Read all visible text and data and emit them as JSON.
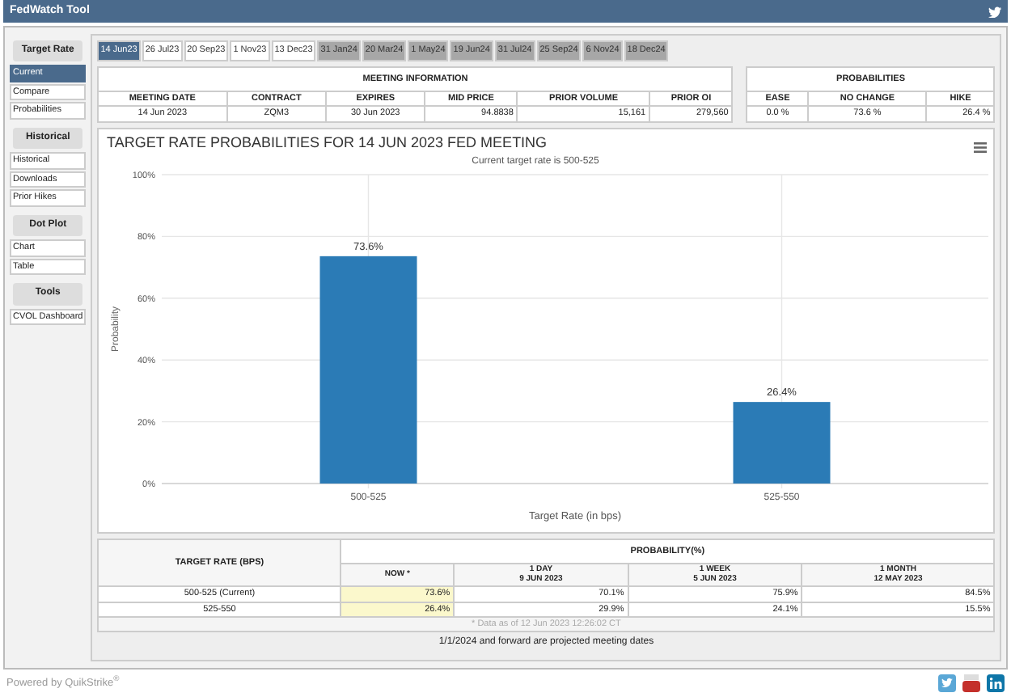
{
  "window": {
    "title": "FedWatch Tool"
  },
  "sidebar": {
    "groups": [
      {
        "heading": "Target Rate",
        "items": [
          {
            "label": "Current",
            "selected": true
          },
          {
            "label": "Compare",
            "selected": false
          },
          {
            "label": "Probabilities",
            "selected": false
          }
        ]
      },
      {
        "heading": "Historical",
        "items": [
          {
            "label": "Historical",
            "selected": false
          },
          {
            "label": "Downloads",
            "selected": false
          },
          {
            "label": "Prior Hikes",
            "selected": false
          }
        ]
      },
      {
        "heading": "Dot Plot",
        "items": [
          {
            "label": "Chart",
            "selected": false
          },
          {
            "label": "Table",
            "selected": false
          }
        ]
      },
      {
        "heading": "Tools",
        "items": [
          {
            "label": "CVOL Dashboard",
            "selected": false
          }
        ]
      }
    ]
  },
  "tabs": [
    {
      "label": "14 Jun23",
      "selected": true,
      "projected": false
    },
    {
      "label": "26 Jul23",
      "selected": false,
      "projected": false
    },
    {
      "label": "20 Sep23",
      "selected": false,
      "projected": false
    },
    {
      "label": "1 Nov23",
      "selected": false,
      "projected": false
    },
    {
      "label": "13 Dec23",
      "selected": false,
      "projected": false
    },
    {
      "label": "31 Jan24",
      "selected": false,
      "projected": true
    },
    {
      "label": "20 Mar24",
      "selected": false,
      "projected": true
    },
    {
      "label": "1 May24",
      "selected": false,
      "projected": true
    },
    {
      "label": "19 Jun24",
      "selected": false,
      "projected": true
    },
    {
      "label": "31 Jul24",
      "selected": false,
      "projected": true
    },
    {
      "label": "25 Sep24",
      "selected": false,
      "projected": true
    },
    {
      "label": "6 Nov24",
      "selected": false,
      "projected": true
    },
    {
      "label": "18 Dec24",
      "selected": false,
      "projected": true
    }
  ],
  "meeting_information": {
    "heading": "MEETING INFORMATION",
    "columns": [
      "MEETING DATE",
      "CONTRACT",
      "EXPIRES",
      "MID PRICE",
      "PRIOR VOLUME",
      "PRIOR OI"
    ],
    "values": [
      "14 Jun 2023",
      "ZQM3",
      "30 Jun 2023",
      "94.8838",
      "15,161",
      "279,560"
    ]
  },
  "probabilities": {
    "heading": "PROBABILITIES",
    "columns": [
      "EASE",
      "NO CHANGE",
      "HIKE"
    ],
    "values": [
      "0.0 %",
      "73.6 %",
      "26.4 %"
    ]
  },
  "chart": {
    "subtitle": "Current target rate is 500-525",
    "chart_data": {
      "type": "bar",
      "title": "TARGET RATE PROBABILITIES FOR 14 JUN 2023 FED MEETING",
      "xlabel": "Target Rate (in bps)",
      "ylabel": "Probability",
      "categories": [
        "500-525",
        "525-550"
      ],
      "values": [
        73.6,
        26.4
      ],
      "ylim": [
        0,
        100
      ],
      "yticks": [
        {
          "value": 0,
          "label": "0%"
        },
        {
          "value": 20,
          "label": "20%"
        },
        {
          "value": 40,
          "label": "40%"
        },
        {
          "value": 60,
          "label": "60%"
        },
        {
          "value": 80,
          "label": "80%"
        },
        {
          "value": 100,
          "label": "100%"
        }
      ],
      "data_labels": true,
      "grid": true,
      "value_labels": [
        "73.6%",
        "26.4%"
      ]
    }
  },
  "probability_table": {
    "rate_heading": "TARGET RATE (BPS)",
    "group_heading": "PROBABILITY(%)",
    "columns": [
      {
        "label": "NOW *",
        "highlighted": true
      },
      {
        "label": "1 DAY",
        "sub": "9 JUN 2023",
        "highlighted": false
      },
      {
        "label": "1 WEEK",
        "sub": "5 JUN 2023",
        "highlighted": false
      },
      {
        "label": "1 MONTH",
        "sub": "12 MAY 2023",
        "highlighted": false
      }
    ],
    "rows": [
      {
        "rate": "500-525 (Current)",
        "values": [
          "73.6%",
          "70.1%",
          "75.9%",
          "84.5%"
        ]
      },
      {
        "rate": "525-550",
        "values": [
          "26.4%",
          "29.9%",
          "24.1%",
          "15.5%"
        ]
      }
    ],
    "note": "* Data as of 12 Jun 2023 12:26:02 CT"
  },
  "footnote": "1/1/2024 and forward are projected meeting dates",
  "footer": {
    "powered_by": "Powered by QuikStrike$^{®}$"
  }
}
